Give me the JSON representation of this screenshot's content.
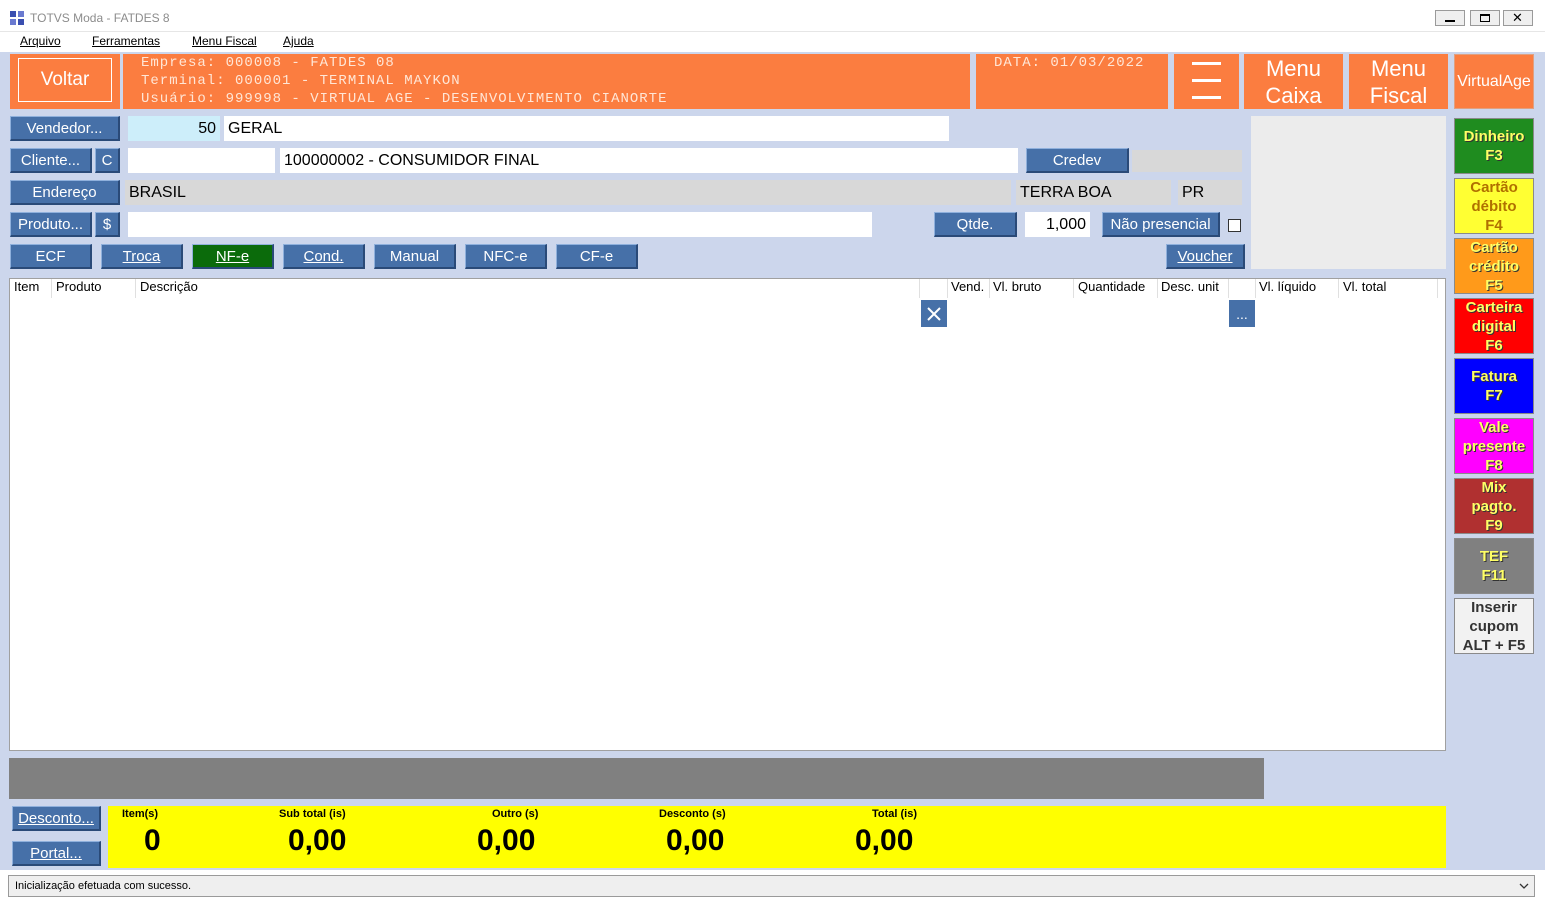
{
  "window": {
    "title": "TOTVS Moda - FATDES 8"
  },
  "menubar": [
    "Arquivo",
    "Ferramentas",
    "Menu Fiscal",
    "Ajuda"
  ],
  "header": {
    "back_label": "Voltar",
    "empresa": "Empresa: 000008 - FATDES 08",
    "terminal": "Terminal: 000001 - TERMINAL MAYKON",
    "usuario": "Usuário: 999998 - VIRTUAL AGE - DESENVOLVIMENTO CIANORTE",
    "data": "DATA: 01/03/2022",
    "menu_caixa": [
      "Menu",
      "Caixa"
    ],
    "menu_fiscal": [
      "Menu",
      "Fiscal"
    ],
    "virtualage": "VirtualAge"
  },
  "form": {
    "vendedor_label": "Vendedor...",
    "vendedor_code": "50",
    "vendedor_name": "GERAL",
    "cliente_label": "Cliente...",
    "cliente_c": "C",
    "cliente_code": "",
    "cliente_name": "100000002 - CONSUMIDOR FINAL",
    "credev_label": "Credev",
    "credev_value": "",
    "endereco_label": "Endereço",
    "pais": "BRASIL",
    "cidade": "TERRA BOA",
    "uf": "PR",
    "produto_label": "Produto...",
    "produto_dollar": "$",
    "produto_value": "",
    "qtde_label": "Qtde.",
    "qtde_value": "1,000",
    "nao_presencial_label": "Não presencial"
  },
  "tabs": [
    "ECF",
    "Troca",
    "NF-e",
    "Cond.",
    "Manual",
    "NFC-e",
    "CF-e"
  ],
  "voucher_label": "Voucher",
  "grid_headers": [
    "Item",
    "Produto",
    "Descrição",
    "Vend.",
    "Vl. bruto",
    "Quantidade",
    "Desc. unit",
    "Vl. líquido",
    "Vl. total"
  ],
  "grid_buttons": {
    "ellipsis": "..."
  },
  "payments": [
    {
      "l1": "Dinheiro",
      "l2": "F3",
      "l3": "",
      "color": "#1f8c1f"
    },
    {
      "l1": "Cartão",
      "l2": "débito",
      "l3": "F4",
      "color": "#ffff33"
    },
    {
      "l1": "Cartão",
      "l2": "crédito",
      "l3": "F5",
      "color": "#ff9a1a"
    },
    {
      "l1": "Carteira",
      "l2": "digital",
      "l3": "F6",
      "color": "#ff0000"
    },
    {
      "l1": "Fatura",
      "l2": "F7",
      "l3": "",
      "color": "#0000ff"
    },
    {
      "l1": "Vale",
      "l2": "presente",
      "l3": "F8",
      "color": "#ff00ff"
    },
    {
      "l1": "Mix",
      "l2": "pagto.",
      "l3": "F9",
      "color": "#b03030"
    },
    {
      "l1": "TEF",
      "l2": "F11",
      "l3": "",
      "color": "#808080"
    },
    {
      "l1": "Inserir",
      "l2": "cupom",
      "l3": "ALT + F5",
      "color": "#f2f2f2"
    }
  ],
  "bottom": {
    "desconto_label": "Desconto...",
    "portal_label": "Portal...",
    "itens_label": "Item(s)",
    "itens_value": "0",
    "subtotal_label": "Sub total (is)",
    "subtotal_value": "0,00",
    "outro_label": "Outro (s)",
    "outro_value": "0,00",
    "desconto_tot_label": "Desconto (s)",
    "desconto_tot_value": "0,00",
    "total_label": "Total (is)",
    "total_value": "0,00"
  },
  "status": "Inicialização efetuada com sucesso."
}
